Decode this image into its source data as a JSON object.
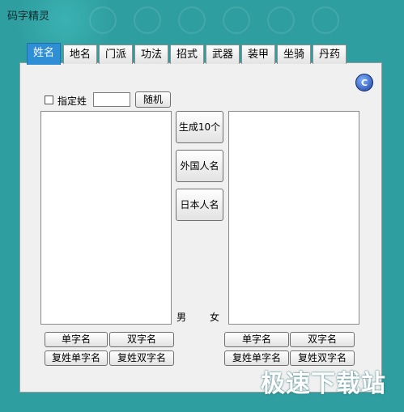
{
  "window": {
    "title": "码字精灵"
  },
  "tabs": [
    {
      "label": "姓名",
      "active": true
    },
    {
      "label": "地名",
      "active": false
    },
    {
      "label": "门派",
      "active": false
    },
    {
      "label": "功法",
      "active": false
    },
    {
      "label": "招式",
      "active": false
    },
    {
      "label": "武器",
      "active": false
    },
    {
      "label": "装甲",
      "active": false
    },
    {
      "label": "坐骑",
      "active": false
    },
    {
      "label": "丹药",
      "active": false
    }
  ],
  "toolbar": {
    "c_button_label": "C"
  },
  "controls": {
    "specify_surname_label": "指定姓",
    "specify_surname_checked": false,
    "surname_value": "",
    "random_button": "随机",
    "generate_button": "生成10个",
    "foreign_name_button": "外国人名",
    "japanese_name_button": "日本人名",
    "male_label": "男",
    "female_label": "女"
  },
  "left_buttons": {
    "single_char": "单字名",
    "double_char": "双字名",
    "compound_single": "复姓单字名",
    "compound_double": "复姓双字名"
  },
  "right_buttons": {
    "single_char": "单字名",
    "double_char": "双字名",
    "compound_single": "复姓单字名",
    "compound_double": "复姓双字名"
  },
  "watermark": "极速下载站",
  "colors": {
    "background": "#2f9ea0",
    "active_tab": "#2f8fd6",
    "panel": "#f0f0f0"
  }
}
